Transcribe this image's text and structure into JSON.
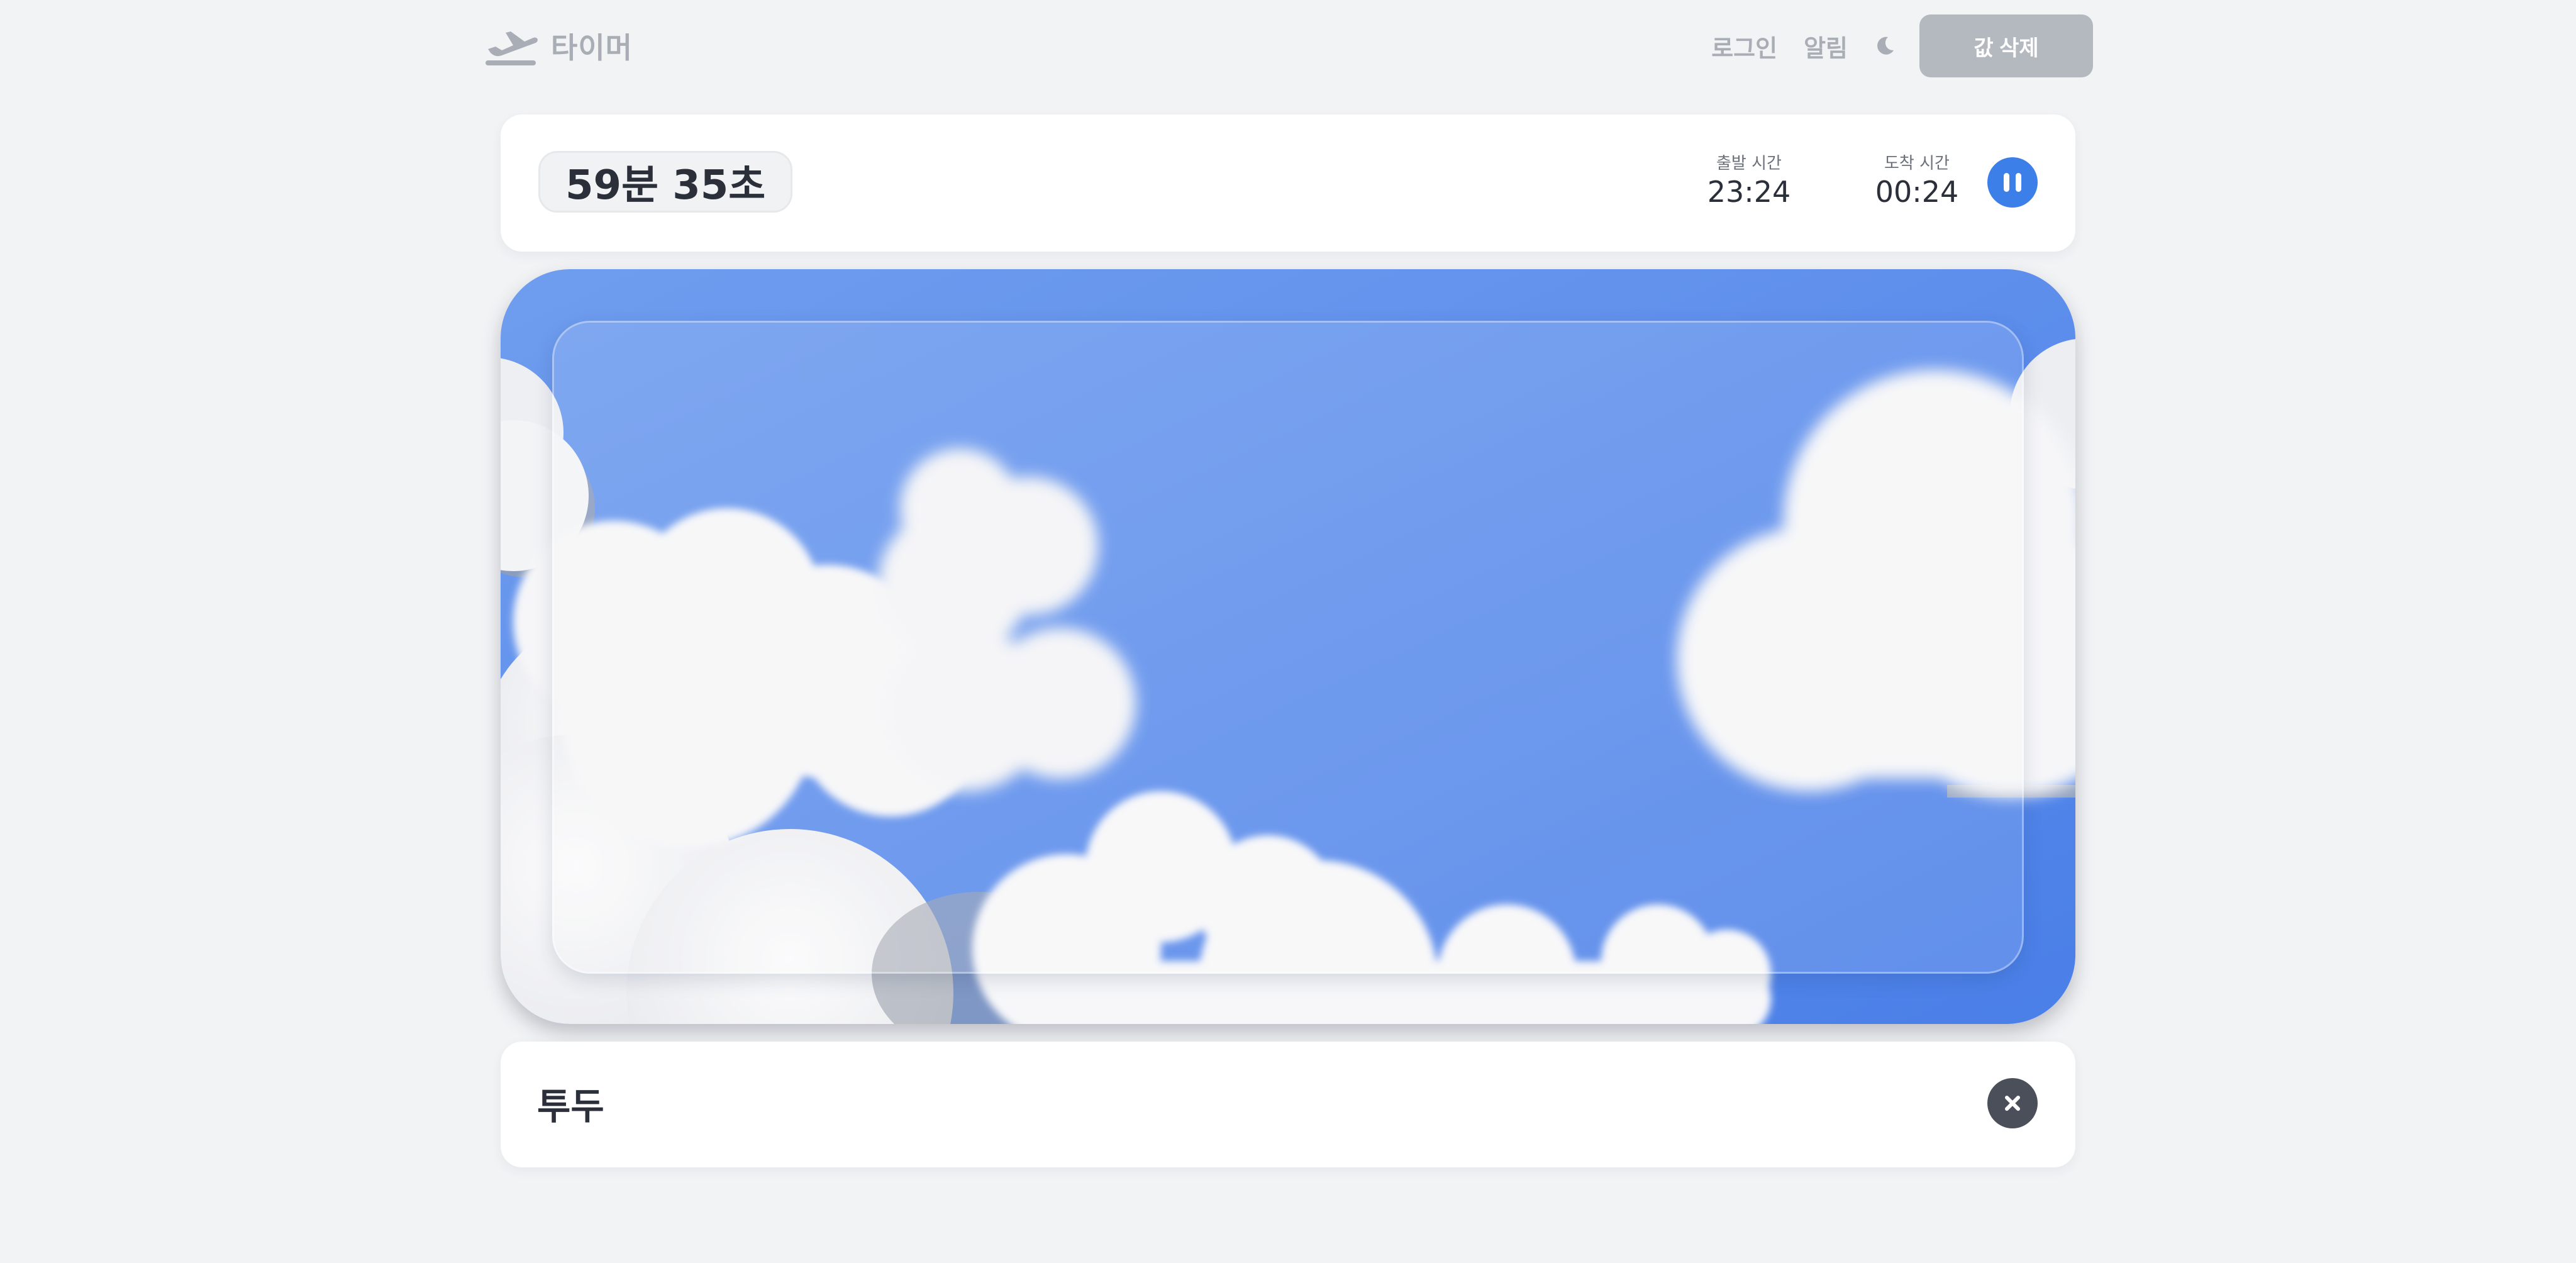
{
  "app": {
    "brand_name": "타이머",
    "brand_icon": "airplane-takeoff-icon"
  },
  "nav": {
    "login_label": "로그인",
    "alerts_label": "알림",
    "theme_icon": "moon-icon",
    "delete_label": "값 삭제"
  },
  "timer": {
    "remaining": "59분 35초",
    "departure_label": "출발 시간",
    "departure_time": "23:24",
    "arrival_label": "도착 시간",
    "arrival_time": "00:24",
    "pause_icon": "pause-icon"
  },
  "todo": {
    "title": "투두",
    "close_icon": "close-icon"
  },
  "colors": {
    "background": "#f2f3f5",
    "accent": "#3d7fe8",
    "sky_top": "#6f9dee",
    "sky_bottom": "#4a7fe8",
    "delete_button": "#b4b9c0",
    "close_button": "#4b4f59"
  }
}
